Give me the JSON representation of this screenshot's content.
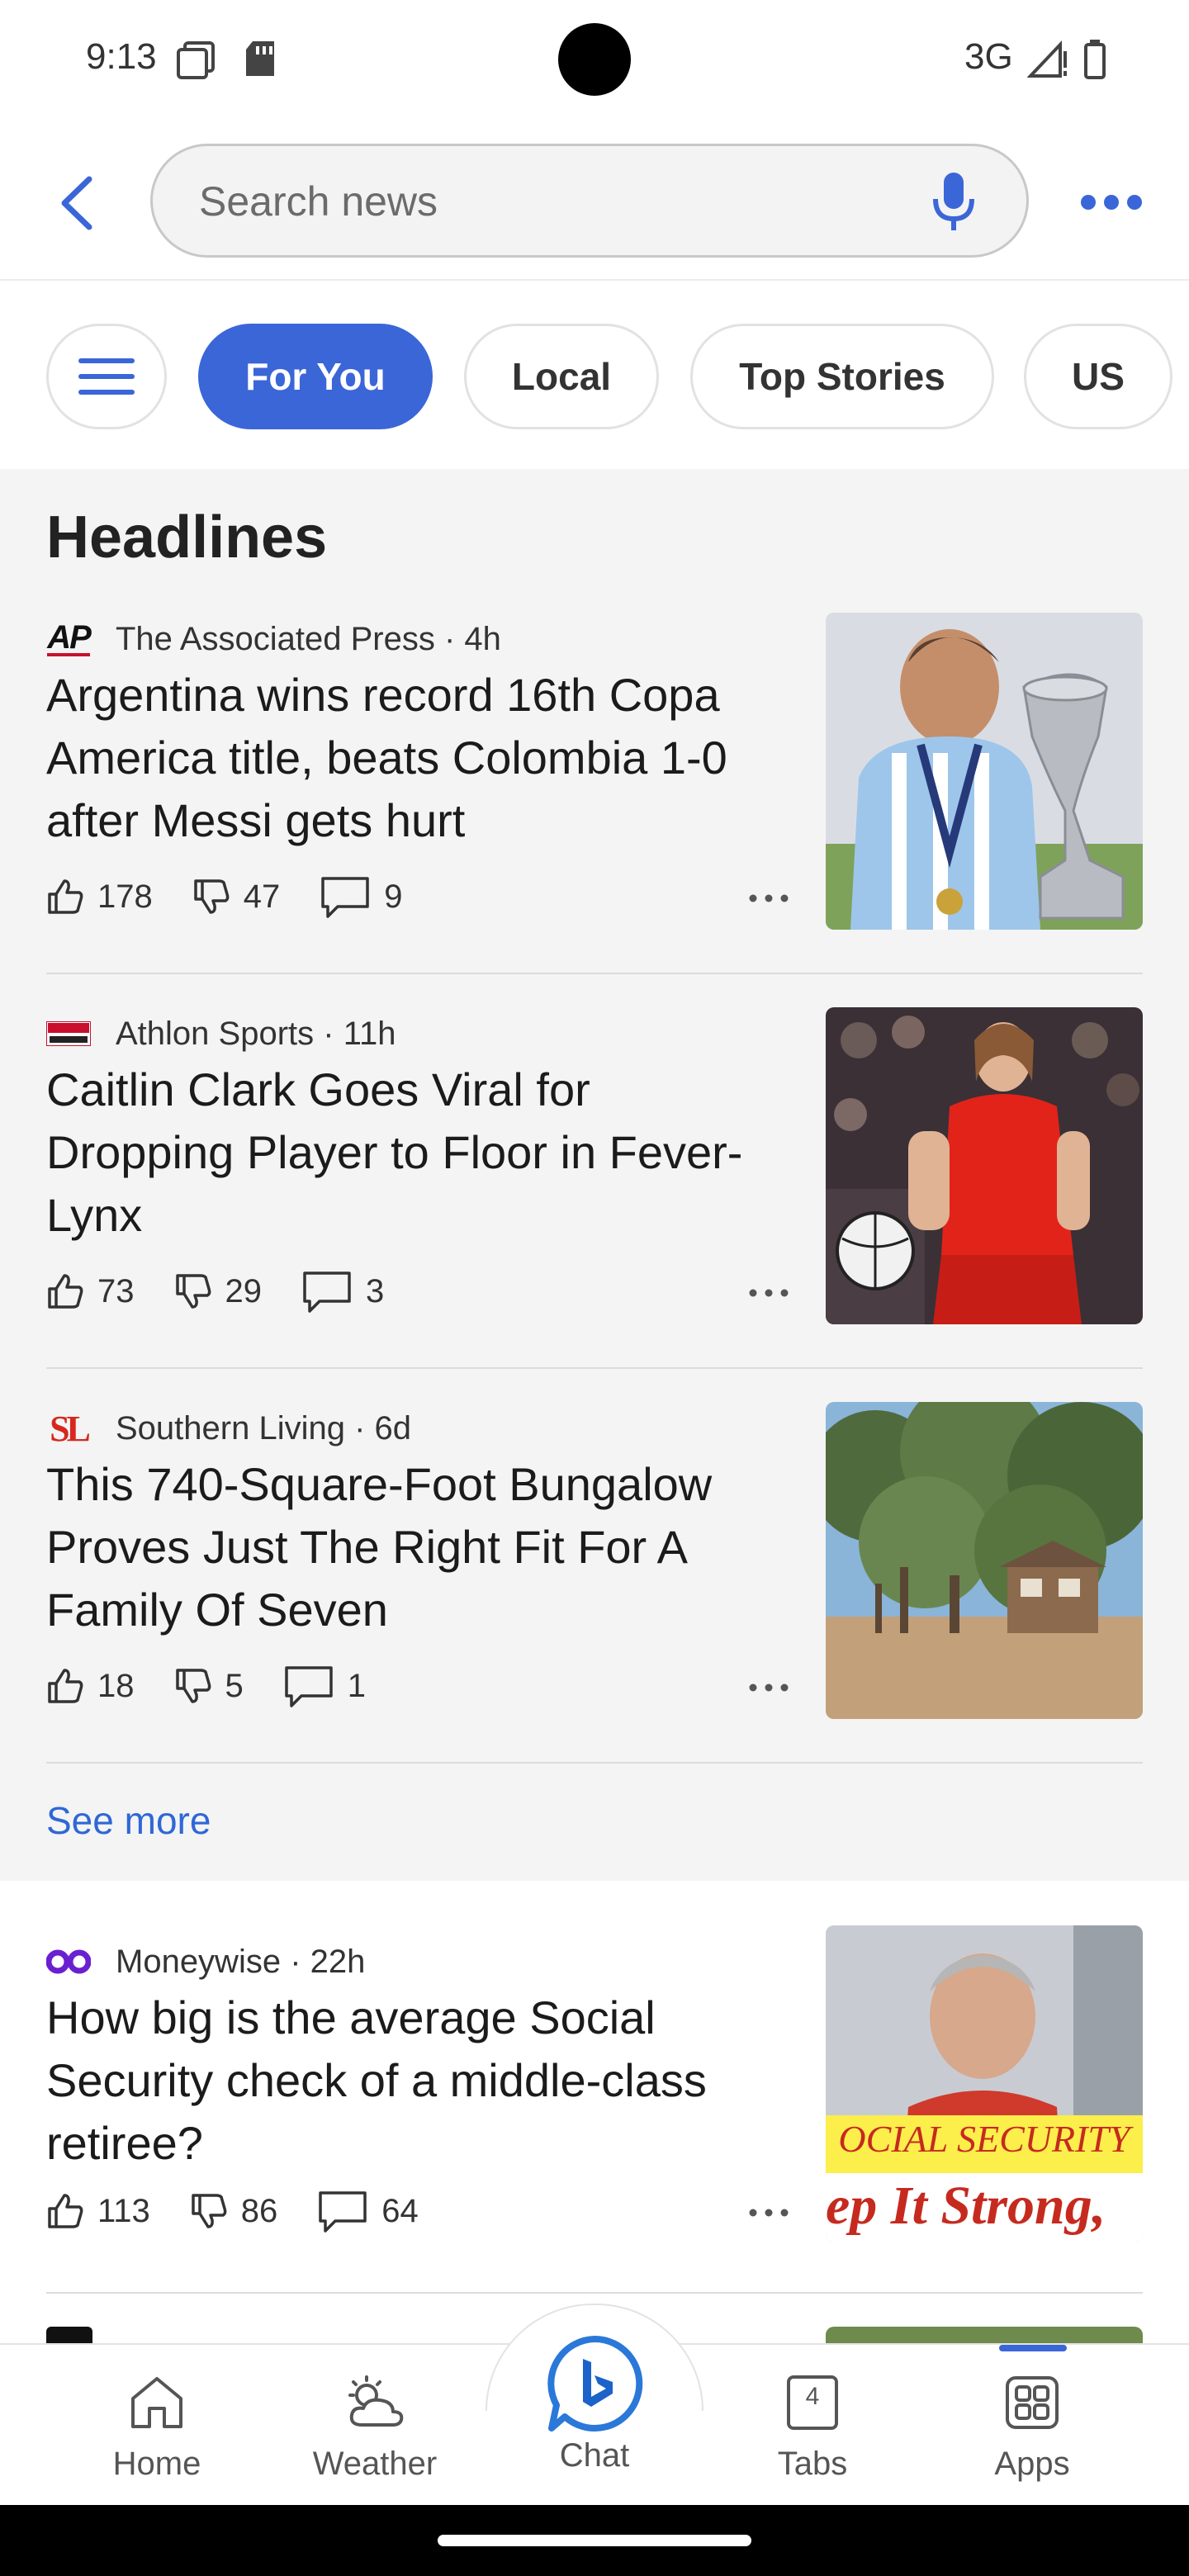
{
  "status_bar": {
    "time": "9:13",
    "network": "3G"
  },
  "search": {
    "placeholder": "Search news"
  },
  "tabs": [
    {
      "label": "For You",
      "active": true
    },
    {
      "label": "Local",
      "active": false
    },
    {
      "label": "Top Stories",
      "active": false
    },
    {
      "label": "US",
      "active": false
    }
  ],
  "headlines": {
    "title": "Headlines",
    "see_more": "See more",
    "articles": [
      {
        "source": "The Associated Press",
        "logo_text": "AP",
        "age": "4h",
        "title": "Argentina wins record 16th Copa America title, beats Colombia 1-0 after Messi gets hurt",
        "likes": "178",
        "dislikes": "47",
        "comments": "9"
      },
      {
        "source": "Athlon Sports",
        "logo_text": "ATHLON SPORTS",
        "age": "11h",
        "title": "Caitlin Clark Goes Viral for Dropping Player to Floor in Fever-Lynx",
        "likes": "73",
        "dislikes": "29",
        "comments": "3"
      },
      {
        "source": "Southern Living",
        "logo_text": "SL",
        "age": "6d",
        "title": "This 740-Square-Foot Bungalow Proves Just The Right Fit For A Family Of Seven",
        "likes": "18",
        "dislikes": "5",
        "comments": "1"
      }
    ]
  },
  "feed": [
    {
      "source": "Moneywise",
      "age": "22h",
      "title": "How big is the average Social Security check of a middle-class retiree?",
      "likes": "113",
      "dislikes": "86",
      "comments": "64",
      "image_text_1": "OCIAL SECURITY",
      "image_text_2": "ep It Strong,"
    }
  ],
  "bottom_nav": [
    {
      "label": "Home",
      "icon": "home-icon"
    },
    {
      "label": "Weather",
      "icon": "weather-icon"
    },
    {
      "label": "Chat",
      "icon": "bing-chat-icon"
    },
    {
      "label": "Tabs",
      "icon": "tabs-icon",
      "count": "4"
    },
    {
      "label": "Apps",
      "icon": "apps-grid-icon"
    }
  ],
  "colors": {
    "accent": "#3b66d8",
    "link": "#2f67d6",
    "section_bg": "#f4f4f4"
  }
}
